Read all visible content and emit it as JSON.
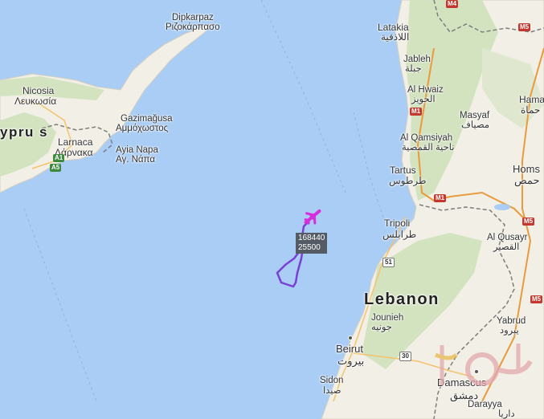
{
  "flight": {
    "id": "168440",
    "altitude": "25500",
    "color": "#7a3fd6"
  },
  "labels": {
    "dipkarpaz": "Dipkarpaz",
    "rizokarpaso": "Ριζοκάρπασο",
    "nicosia": "Nicosia",
    "lefkosia": "Λευκωσία",
    "cyprus": "ypru s",
    "gazimagusa": "Gazimağusa",
    "ammochostos": "Αμμόχωστος",
    "larnaca": "Larnaca",
    "larnaka": "Λάρνακα",
    "ayianapa": "Ayia Napa",
    "agnapa": "Αγ. Νάπα",
    "latakia": "Latakia",
    "latakia_ar": "اللاذقية",
    "jableh": "Jableh",
    "jableh_ar": "جبلة",
    "alhwaiz": "Al Hwaiz",
    "alhwaiz_ar": "الحويز",
    "masyaf": "Masyaf",
    "masyaf_ar": "مصياف",
    "alqamsiyah": "Al Qamsiyah",
    "alqamsiyah_ar": "ناحية القمصية",
    "hama": "Hama",
    "hama_ar": "حماة",
    "tartus": "Tartus",
    "tartus_ar": "طرطوس",
    "homs": "Homs",
    "homs_ar": "حمص",
    "tripoli": "Tripoli",
    "tripoli_ar": "طرابلس",
    "alqusayr": "Al Qusayr",
    "alqusayr_ar": "القصير",
    "lebanon": "Lebanon",
    "jounieh": "Jounieh",
    "jounieh_ar": "جونيه",
    "yabrud": "Yabrud",
    "yabrud_ar": "يبرود",
    "beirut": "Beirut",
    "beirut_ar": "بيروت",
    "sidon": "Sidon",
    "sidon_ar": "صيدا",
    "damascus": "Damascus",
    "damascus_ar": "دمشق",
    "darayya": "Darayya",
    "darayya_ar": "داريا"
  },
  "shields": {
    "m4": "M4",
    "m5a": "M5",
    "m1a": "M1",
    "m1b": "M1",
    "m5b": "M5",
    "m5c": "M5",
    "a1": "A1",
    "a5": "A5",
    "r51": "51",
    "r30": "30"
  },
  "colors": {
    "sea": "#a9cdf5",
    "land": "#f2efe6",
    "green": "#d3e3c0",
    "border": "#7d7d7d",
    "route": "#7a3fd6"
  }
}
